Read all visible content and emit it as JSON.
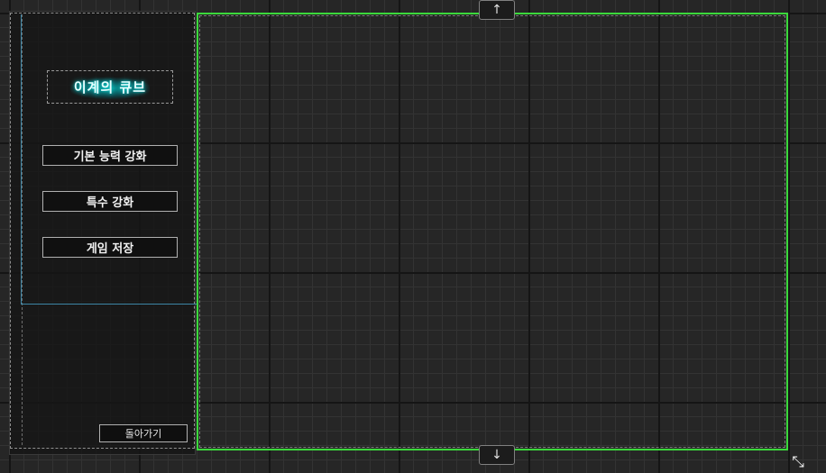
{
  "menu": {
    "title": "이계의 큐브",
    "items": [
      {
        "label": "기본 능력 강화"
      },
      {
        "label": "특수 강화"
      },
      {
        "label": "게임 저장"
      }
    ],
    "back_label": "돌아가기"
  },
  "scroll": {
    "up_icon": "arrow-up-icon",
    "up_glyph": "↑",
    "down_icon": "arrow-down-icon",
    "down_glyph": "↓"
  },
  "resize": {
    "icon": "diagonal-resize-icon",
    "glyph": "⤡"
  },
  "colors": {
    "background": "#262626",
    "grid_major": "#151515",
    "grid_minor": "#333333",
    "main_border": "#3bd83b",
    "menu_frame": "#3d86a6",
    "title_glow": "#19d3d3"
  }
}
